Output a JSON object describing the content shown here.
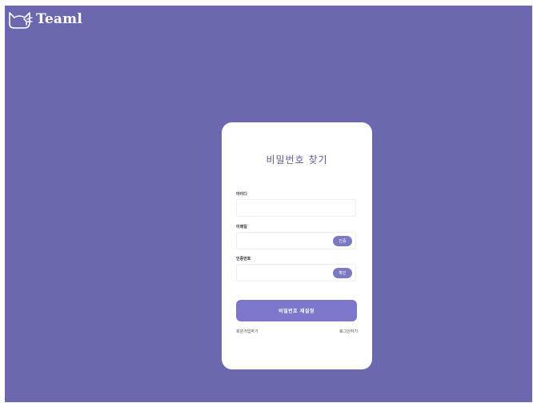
{
  "brand": {
    "name": "Teaml",
    "icon": "cat-outline-icon"
  },
  "colors": {
    "background": "#6b68b0",
    "accent": "#7b78cc",
    "title": "#5c5a9e"
  },
  "form": {
    "title": "비밀번호 찾기",
    "fields": {
      "id": {
        "label": "아이디",
        "value": ""
      },
      "email": {
        "label": "이메일",
        "value": "",
        "button": "인증"
      },
      "code": {
        "label": "인증번호",
        "value": "",
        "button": "확인"
      }
    },
    "submit": "비밀번호 재설정",
    "links": {
      "signup": "회원가입하기",
      "login": "로그인하기"
    }
  }
}
